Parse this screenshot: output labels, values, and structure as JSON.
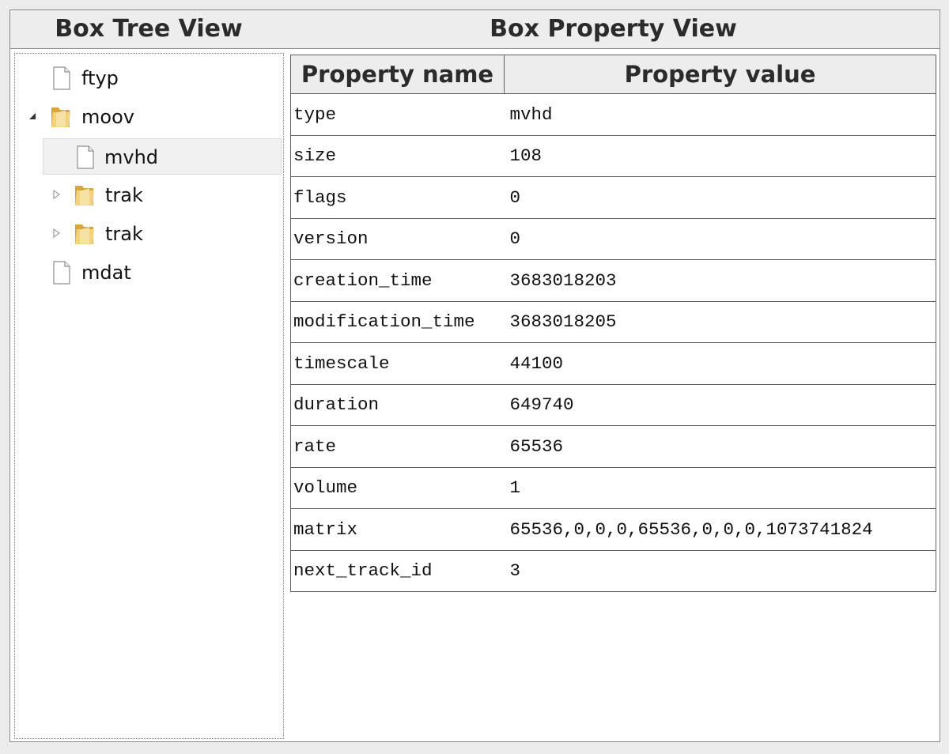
{
  "panels": {
    "tree_title": "Box Tree View",
    "property_title": "Box Property View"
  },
  "tree": {
    "items": [
      {
        "label": "ftyp",
        "icon": "file-icon"
      },
      {
        "label": "moov",
        "icon": "folder-icon",
        "expanded": true
      },
      {
        "label": "mvhd",
        "icon": "file-icon",
        "selected": true
      },
      {
        "label": "trak",
        "icon": "folder-icon",
        "expanded": false
      },
      {
        "label": "trak",
        "icon": "folder-icon",
        "expanded": false
      },
      {
        "label": "mdat",
        "icon": "file-icon"
      }
    ]
  },
  "table": {
    "headers": [
      "Property name",
      "Property value"
    ],
    "rows": [
      {
        "name": "type",
        "value": "mvhd"
      },
      {
        "name": "size",
        "value": "108"
      },
      {
        "name": "flags",
        "value": "0"
      },
      {
        "name": "version",
        "value": "0"
      },
      {
        "name": "creation_time",
        "value": "3683018203"
      },
      {
        "name": "modification_time",
        "value": "3683018205"
      },
      {
        "name": "timescale",
        "value": "44100"
      },
      {
        "name": "duration",
        "value": "649740"
      },
      {
        "name": "rate",
        "value": "65536"
      },
      {
        "name": "volume",
        "value": "1"
      },
      {
        "name": "matrix",
        "value": "65536,0,0,0,65536,0,0,0,1073741824"
      },
      {
        "name": "next_track_id",
        "value": "3"
      }
    ]
  },
  "colors": {
    "header_bg": "#ededed",
    "border": "#5f5f5f",
    "selected_bg": "#f1f1f1",
    "folder": "#e8c26a"
  }
}
